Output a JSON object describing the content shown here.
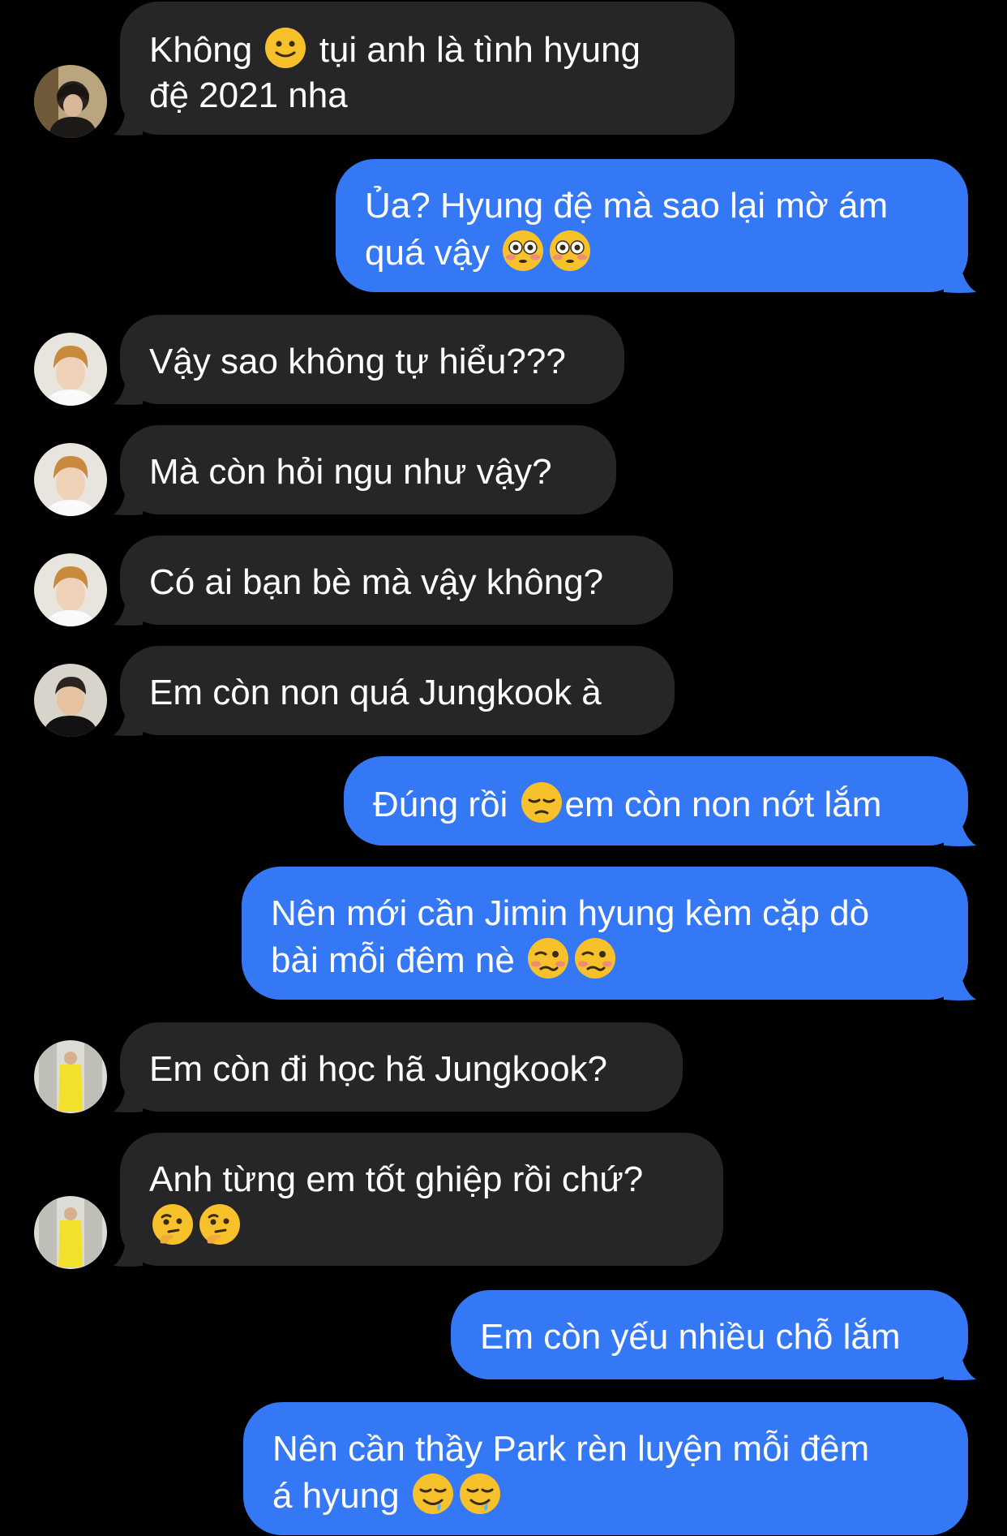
{
  "conversation": {
    "messages": [
      {
        "side": "in",
        "avatar": "dark-hair-avatar",
        "parts": [
          "Không ",
          "tụi anh là tình hyung",
          "đệ 2021 nha"
        ],
        "emojis": [
          "slightly-smiling-face-icon"
        ]
      },
      {
        "side": "out",
        "parts": [
          "Ủa? Hyung đệ mà sao lại mờ ám",
          "quá vậy "
        ],
        "emojis": [
          "flushed-face-icon",
          "flushed-face-icon"
        ]
      },
      {
        "side": "in",
        "avatar": "blond-hair-avatar",
        "parts": [
          "Vậy sao không tự hiểu???"
        ]
      },
      {
        "side": "in",
        "avatar": "blond-hair-avatar",
        "parts": [
          "Mà còn hỏi ngu như vậy?"
        ]
      },
      {
        "side": "in",
        "avatar": "blond-hair-avatar",
        "parts": [
          "Có ai bạn bè mà vậy không?"
        ]
      },
      {
        "side": "in",
        "avatar": "black-shirt-avatar",
        "parts": [
          "Em còn non quá Jungkook à"
        ]
      },
      {
        "side": "out",
        "parts": [
          "Đúng rồi ",
          "em còn non nớt lắm"
        ],
        "emojis": [
          "pensive-face-icon"
        ]
      },
      {
        "side": "out",
        "parts": [
          "Nên mới cần Jimin hyung kèm cặp dò",
          "bài mỗi đêm nè "
        ],
        "emojis": [
          "woozy-face-icon",
          "woozy-face-icon"
        ]
      },
      {
        "side": "in",
        "avatar": "yellow-suit-avatar",
        "parts": [
          "Em còn đi học hã Jungkook?"
        ]
      },
      {
        "side": "in",
        "avatar": "yellow-suit-avatar",
        "parts": [
          "Anh từng em tốt ghiệp rồi chứ?"
        ],
        "emojis": [
          "thinking-face-icon",
          "thinking-face-icon"
        ]
      },
      {
        "side": "out",
        "parts": [
          "Em còn yếu nhiều chỗ lắm"
        ]
      },
      {
        "side": "out",
        "parts": [
          "Nên cần thầy Park rèn luyện mỗi đêm",
          "á hyung "
        ],
        "emojis": [
          "drooling-face-icon",
          "drooling-face-icon"
        ]
      }
    ]
  },
  "colors": {
    "incoming_bubble": "#262628",
    "outgoing_bubble": "#3478f6",
    "background": "#000000"
  }
}
